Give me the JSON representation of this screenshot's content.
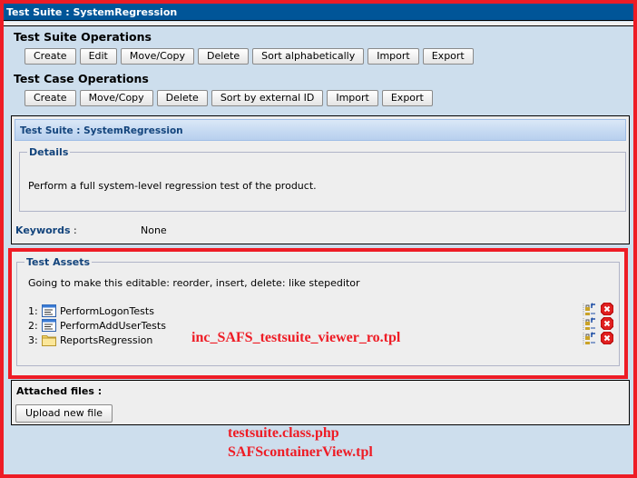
{
  "window": {
    "title": "Test Suite : SystemRegression"
  },
  "suite_ops": {
    "heading": "Test Suite Operations",
    "buttons": [
      "Create",
      "Edit",
      "Move/Copy",
      "Delete",
      "Sort alphabetically",
      "Import",
      "Export"
    ]
  },
  "case_ops": {
    "heading": "Test Case Operations",
    "buttons": [
      "Create",
      "Move/Copy",
      "Delete",
      "Sort by external ID",
      "Import",
      "Export"
    ]
  },
  "info": {
    "panel_title": "Test Suite : SystemRegression",
    "details_legend": "Details",
    "details_text": "Perform a full system-level regression test of the product.",
    "keywords_label": "Keywords",
    "keywords_colon": " :",
    "keywords_value": "None"
  },
  "assets": {
    "legend": "Test Assets",
    "note": "Going to make this editable: reorder, insert, delete: like stepeditor",
    "items": [
      {
        "num": "1:",
        "icon": "test-case-icon",
        "name": "PerformLogonTests"
      },
      {
        "num": "2:",
        "icon": "test-case-icon",
        "name": "PerformAddUserTests"
      },
      {
        "num": "3:",
        "icon": "folder-icon",
        "name": "ReportsRegression"
      }
    ],
    "annotation": "inc_SAFS_testsuite_viewer_ro.tpl"
  },
  "attachments": {
    "label": "Attached files :",
    "upload_button": "Upload new file"
  },
  "annotations": {
    "line1": "testsuite.class.php",
    "line2": "SAFScontainerView.tpl"
  },
  "colors": {
    "annotation_red": "#ee1c25",
    "title_bar_blue": "#005598",
    "page_bg": "#cddeed",
    "label_blue": "#13447c"
  }
}
